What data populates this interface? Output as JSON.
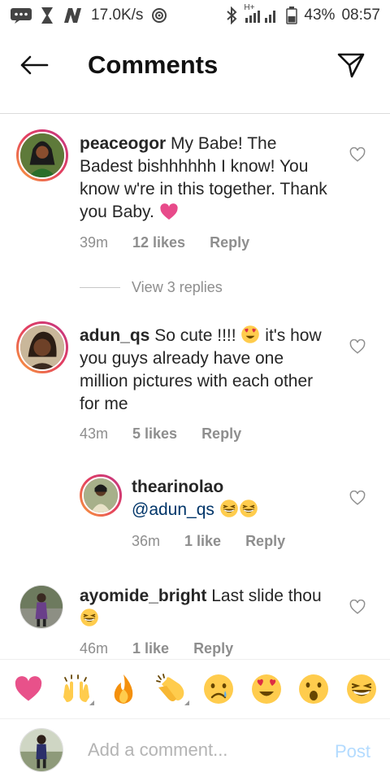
{
  "status_bar": {
    "speed": "17.0K/s",
    "network": "H+",
    "battery": "43%",
    "time": "08:57"
  },
  "header": {
    "title": "Comments",
    "back_icon": "arrow-left-icon",
    "send_icon": "paper-plane-icon"
  },
  "comments": [
    {
      "username": "peaceogor",
      "text": "My Babe! The Badest bishhhhhh I know! You know w're in this together. Thank you Baby.",
      "trailing_emoji": "pink-heart",
      "time": "39m",
      "likes": "12 likes",
      "reply": "Reply"
    },
    {
      "username": "adun_qs",
      "text_before_emoji": "So cute !!!! ",
      "inline_emoji": "heart-eyes",
      "text_after_emoji": " it's how you guys already have one million pictures with each other for me",
      "time": "43m",
      "likes": "5 likes",
      "reply": "Reply"
    },
    {
      "username": "ayomide_bright",
      "text": "Last slide thou",
      "trailing_emoji": "grinning-squinting",
      "time": "46m",
      "likes": "1 like",
      "reply": "Reply"
    }
  ],
  "view_replies": "View 3 replies",
  "reply": {
    "username": "thearinolao",
    "mention": "@adun_qs",
    "emojis": [
      "grinning-squinting",
      "grinning-squinting"
    ],
    "time": "36m",
    "likes": "1 like",
    "reply": "Reply"
  },
  "emoji_bar": [
    "red-heart",
    "raising-hands",
    "fire",
    "clapping-hands",
    "sad-face",
    "heart-eyes",
    "surprised-face",
    "grinning-squinting"
  ],
  "composer": {
    "placeholder": "Add a comment...",
    "post_label": "Post"
  },
  "colors": {
    "accent_blue": "#b3dbff",
    "mention": "#003569",
    "meta_gray": "#8e8e8e",
    "ring_gradient": [
      "#f9a23a",
      "#e4405f",
      "#c13584"
    ]
  }
}
